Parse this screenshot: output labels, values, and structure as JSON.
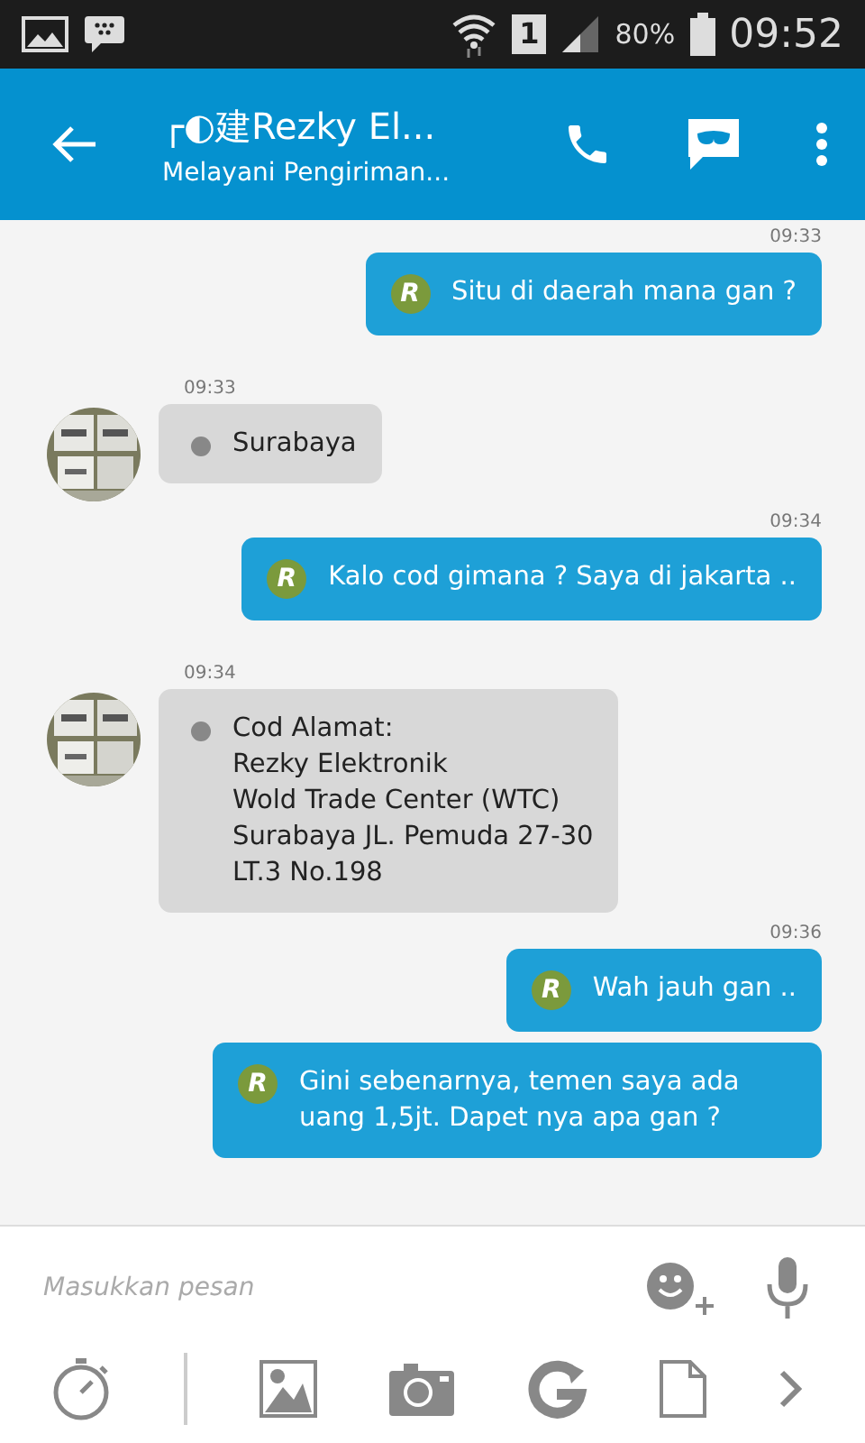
{
  "status_bar": {
    "sim": "1",
    "battery": "80%",
    "time": "09:52"
  },
  "app_bar": {
    "title": "┌◐建Rezky El...",
    "subtitle": "Melayani Pengiriman..."
  },
  "messages": [
    {
      "kind": "outgoing",
      "time": "09:33",
      "badge": "R",
      "text": "Situ di daerah mana gan ?"
    },
    {
      "kind": "incoming",
      "time": "09:33",
      "text": "Surabaya"
    },
    {
      "kind": "outgoing",
      "time": "09:34",
      "badge": "R",
      "text": "Kalo cod gimana ? Saya di jakarta .."
    },
    {
      "kind": "incoming",
      "time": "09:34",
      "text": "Cod Alamat:\nRezky Elektronik\nWold Trade Center (WTC)\nSurabaya JL. Pemuda 27-30\nLT.3 No.198"
    },
    {
      "kind": "outgoing",
      "time": "09:36",
      "badge": "R",
      "text": "Wah jauh gan .."
    },
    {
      "kind": "outgoing",
      "badge": "R",
      "text": "Gini sebenarnya, temen saya ada uang 1,5jt. Dapet nya apa gan ?"
    }
  ],
  "composer": {
    "placeholder": "Masukkan pesan"
  }
}
